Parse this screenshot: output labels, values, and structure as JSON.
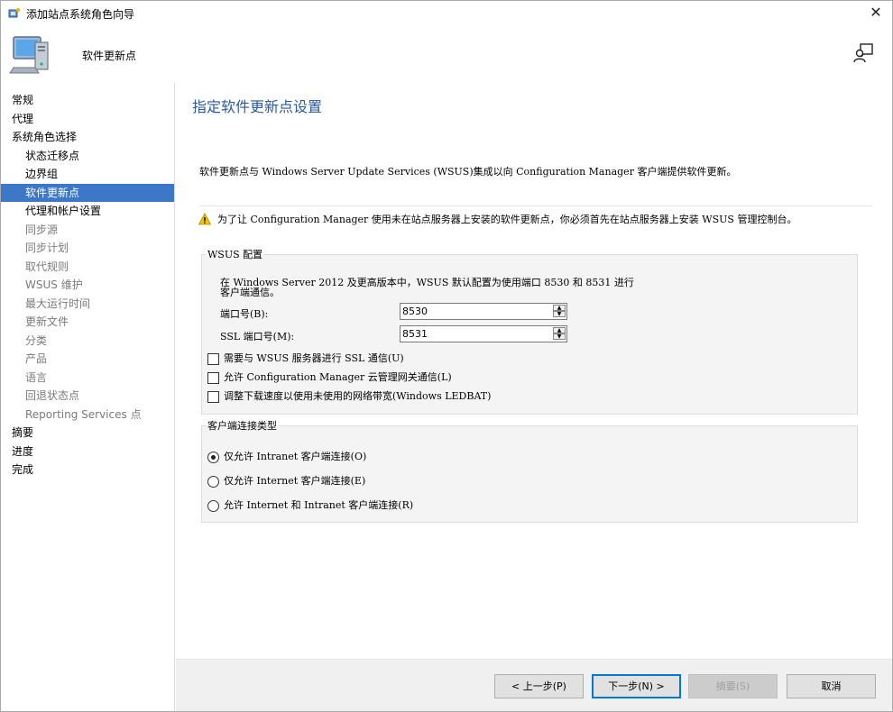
{
  "window": {
    "title": "添加站点系统角色向导",
    "close_glyph": "✕",
    "icon": "wizard-icon"
  },
  "header": {
    "title": "软件更新点",
    "banner_icon": "computer-icon",
    "help_icon": "user-help-icon"
  },
  "sidebar": {
    "items": [
      {
        "label": "常规",
        "level": 0,
        "state": "normal"
      },
      {
        "label": "代理",
        "level": 0,
        "state": "normal"
      },
      {
        "label": "系统角色选择",
        "level": 0,
        "state": "normal"
      },
      {
        "label": "状态迁移点",
        "level": 1,
        "state": "normal"
      },
      {
        "label": "边界组",
        "level": 1,
        "state": "normal"
      },
      {
        "label": "软件更新点",
        "level": 1,
        "state": "active"
      },
      {
        "label": "代理和帐户设置",
        "level": 1,
        "state": "normal"
      },
      {
        "label": "同步源",
        "level": 1,
        "state": "muted"
      },
      {
        "label": "同步计划",
        "level": 1,
        "state": "muted"
      },
      {
        "label": "取代规则",
        "level": 1,
        "state": "muted"
      },
      {
        "label": "WSUS 维护",
        "level": 1,
        "state": "muted"
      },
      {
        "label": "最大运行时间",
        "level": 1,
        "state": "muted"
      },
      {
        "label": "更新文件",
        "level": 1,
        "state": "muted"
      },
      {
        "label": "分类",
        "level": 1,
        "state": "muted"
      },
      {
        "label": "产品",
        "level": 1,
        "state": "muted"
      },
      {
        "label": "语言",
        "level": 1,
        "state": "muted"
      },
      {
        "label": "回退状态点",
        "level": 1,
        "state": "muted"
      },
      {
        "label": "Reporting Services 点",
        "level": 1,
        "state": "muted"
      },
      {
        "label": "摘要",
        "level": 0,
        "state": "normal"
      },
      {
        "label": "进度",
        "level": 0,
        "state": "normal"
      },
      {
        "label": "完成",
        "level": 0,
        "state": "normal"
      }
    ]
  },
  "main": {
    "page_title": "指定软件更新点设置",
    "intro": "软件更新点与 Windows Server Update Services (WSUS)集成以向 Configuration Manager 客户端提供软件更新。",
    "warning": "为了让 Configuration Manager 使用未在站点服务器上安装的软件更新点，你必须首先在站点服务器上安装 WSUS 管理控制台。",
    "warning_icon": "warning-icon",
    "wsus": {
      "legend": "WSUS 配置",
      "desc_line1": "在 Windows Server 2012 及更高版本中，WSUS 默认配置为使用端口 8530 和 8531 进行",
      "desc_line2": "客户端通信。",
      "port_label": "端口号(B):",
      "port_value": "8530",
      "ssl_port_label": "SSL 端口号(M):",
      "ssl_port_value": "8531",
      "checkboxes": [
        {
          "label": "需要与 WSUS 服务器进行 SSL 通信(U)",
          "checked": false
        },
        {
          "label": "允许 Configuration Manager 云管理网关通信(L)",
          "checked": false
        },
        {
          "label": "调整下载速度以使用未使用的网络带宽(Windows LEDBAT)",
          "checked": false
        }
      ]
    },
    "client": {
      "legend": "客户端连接类型",
      "options": [
        {
          "label": "仅允许 Intranet 客户端连接(O)",
          "selected": true
        },
        {
          "label": "仅允许 Internet 客户端连接(E)",
          "selected": false
        },
        {
          "label": "允许 Internet 和 Intranet 客户端连接(R)",
          "selected": false
        }
      ]
    }
  },
  "footer": {
    "prev": "< 上一步(P)",
    "next": "下一步(N) >",
    "summary": "摘要(S)",
    "cancel": "取消"
  }
}
